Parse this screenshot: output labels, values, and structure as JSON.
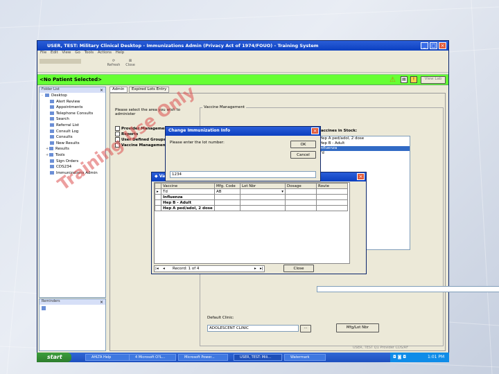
{
  "window": {
    "title": "USER, TEST: Military Clinical Desktop - Immunizations Admin (Privacy Act of 1974/FOUO) - Training System",
    "menu": [
      "File",
      "Edit",
      "View",
      "Go",
      "Tools",
      "Actions",
      "Help"
    ],
    "toolbar": {
      "refresh_label": "Refresh",
      "close_label": "Close"
    },
    "patient_banner": "<No Patient Selected>",
    "banner_btn_label": "View Lab"
  },
  "folder_list": {
    "header": "Folder List",
    "items": [
      {
        "label": "Desktop",
        "expander": "-"
      },
      {
        "label": "Alert Review"
      },
      {
        "label": "Appointments"
      },
      {
        "label": "Telephone Consults"
      },
      {
        "label": "Search"
      },
      {
        "label": "Referral List"
      },
      {
        "label": "Consult Log"
      },
      {
        "label": "Consults"
      },
      {
        "label": "New Results"
      },
      {
        "label": "Results",
        "expander": "+"
      },
      {
        "label": "Tools",
        "expander": "+"
      },
      {
        "label": "Sign Orders"
      },
      {
        "label": "CDS234"
      },
      {
        "label": "Immunizations Admin"
      }
    ]
  },
  "reminders": {
    "header": "Reminders"
  },
  "tabs": [
    "Admin",
    "Expired Lots Entry"
  ],
  "admin": {
    "instruction": "Please select the area you wish to administer",
    "options": [
      "Provider Management",
      "Reports",
      "User Defined Groups",
      "Vaccine Management"
    ]
  },
  "vaccine_mgmt": {
    "title": "Vaccine Management",
    "in_stock_label": "Vaccines in Stock:",
    "stock_items": [
      "Hep A ped/adol, 2 dose",
      "Hep B - Adult",
      "Influenza",
      "Td"
    ],
    "selected_index": 2
  },
  "default_clinic": {
    "label": "Default Clinic:",
    "value": "ADOLESCENT CLINIC",
    "browse_label": "...",
    "button_label": "Mfg/Lot Nbr"
  },
  "change_dialog": {
    "title": "Change Immunization Info",
    "prompt": "Please enter the lot number:",
    "ok_label": "OK",
    "cancel_label": "Cancel",
    "input_value": "1234"
  },
  "lot_dialog": {
    "title": "Va",
    "columns": [
      "Vaccine",
      "Mfg. Code",
      "Lot Nbr",
      "Dosage",
      "Route"
    ],
    "rows": [
      {
        "vaccine": "Td",
        "mfg": "AB",
        "lot": "",
        "dosage": "",
        "route": ""
      },
      {
        "vaccine": "Influenza",
        "mfg": "",
        "lot": "",
        "dosage": "",
        "route": ""
      },
      {
        "vaccine": "Hep B - Adult",
        "mfg": "",
        "lot": "",
        "dosage": "",
        "route": ""
      },
      {
        "vaccine": "Hep A ped/adol, 2 dose",
        "mfg": "",
        "lot": "",
        "dosage": "",
        "route": ""
      }
    ],
    "record_text": "Record: 1 of 4",
    "close_label": "Close"
  },
  "watermark": {
    "line1": "Training Use Only"
  },
  "status_bar": "USER, TEST     Q1 Provider     CDS/RF",
  "taskbar": {
    "start_label": "start",
    "tasks": [
      "AHLTA Help",
      "4 Microsoft O?L...",
      "Microsoft Power...",
      "USER, TEST: Mili...",
      "Watermark"
    ],
    "clock": "1:01 PM"
  },
  "colors": {
    "patient_banner": "#66ff33",
    "title_bar": "#0b3fc0",
    "watermark": "#dc5050"
  }
}
